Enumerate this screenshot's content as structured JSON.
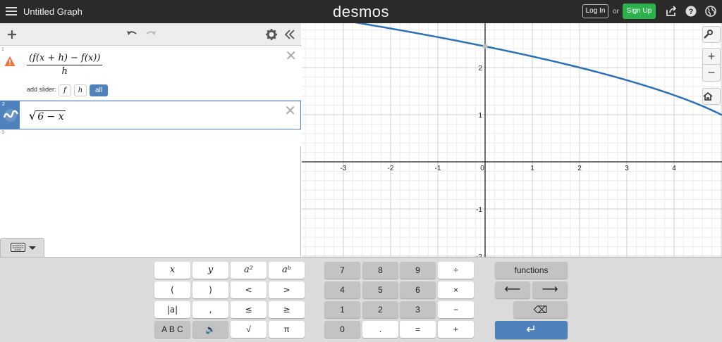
{
  "topbar": {
    "title": "Untitled Graph",
    "brand": "desmos",
    "login_label": "Log In",
    "or_label": "or",
    "signup_label": "Sign Up",
    "signup_color": "#2bb24c"
  },
  "expressions": [
    {
      "number": "1",
      "latex_text": "(f(x+h)−f(x)) / h",
      "numerator": "(f(x + h) − f(x))",
      "denominator": "h",
      "status": "warning",
      "slider_label": "add slider:",
      "slider_options": [
        "f",
        "h",
        "all"
      ]
    },
    {
      "number": "2",
      "radicand": "6 − x",
      "color": "#2d70b3"
    },
    {
      "number": "3"
    }
  ],
  "graph": {
    "x_ticks": [
      "-3",
      "-2",
      "-1",
      "0",
      "1",
      "2",
      "3",
      "4"
    ],
    "y_ticks": [
      "2",
      "1",
      "-1",
      "-2"
    ],
    "zoom_in": "+",
    "zoom_out": "−",
    "curve_color": "#2d70b3"
  },
  "keypad": {
    "left_keys": [
      [
        "x",
        "y",
        "a²",
        "aᵇ"
      ],
      [
        "(",
        ")",
        "<",
        ">"
      ],
      [
        "|a|",
        ",",
        "≤",
        "≥"
      ],
      [
        "A B C",
        "🔊",
        "√",
        "π"
      ]
    ],
    "num_keys": [
      [
        "7",
        "8",
        "9",
        "÷"
      ],
      [
        "4",
        "5",
        "6",
        "×"
      ],
      [
        "1",
        "2",
        "3",
        "−"
      ],
      [
        "0",
        ".",
        "=",
        "+"
      ]
    ],
    "functions_label": "functions",
    "left_arrow": "⟵",
    "right_arrow": "⟶",
    "backspace": "⌫",
    "enter": "↵"
  }
}
